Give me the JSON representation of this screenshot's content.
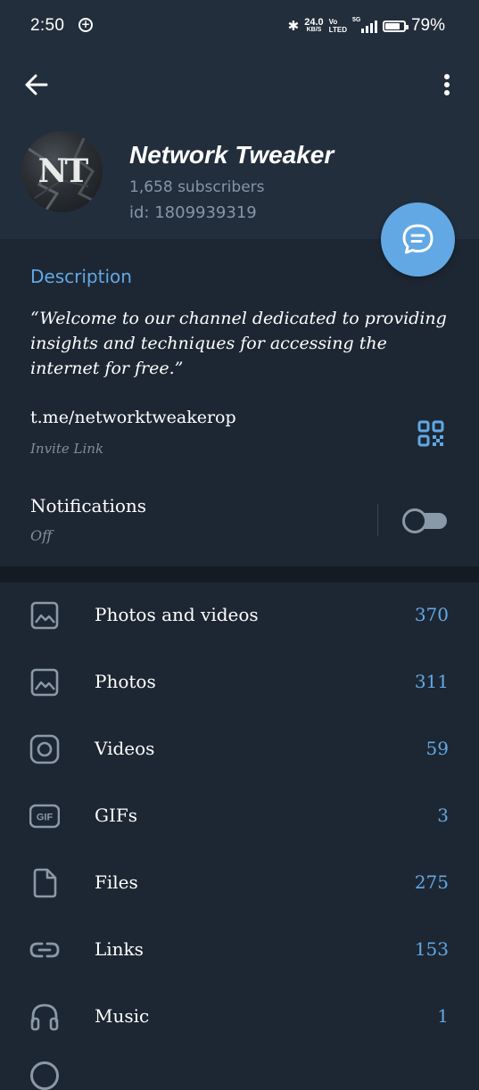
{
  "status_bar": {
    "time": "2:50",
    "speed_value": "24.0",
    "speed_unit": "KB/S",
    "volte_top": "Vo",
    "volte_bottom": "LTED",
    "network": "5G",
    "battery": "79%",
    "battery_level": 0.79
  },
  "header": {
    "avatar_text": "NT",
    "title": "Network Tweaker",
    "subscribers": "1,658 subscribers",
    "id": "id: 1809939319"
  },
  "info": {
    "description_label": "Description",
    "description_text": "“Welcome to our channel dedicated to providing insights and techniques for accessing the internet for free.”",
    "link": "t.me/networktweakerop",
    "link_sub": "Invite Link",
    "notifications_label": "Notifications",
    "notifications_value": "Off",
    "notifications_enabled": false
  },
  "media": [
    {
      "icon": "image-icon",
      "label": "Photos and videos",
      "count": "370"
    },
    {
      "icon": "image-icon",
      "label": "Photos",
      "count": "311"
    },
    {
      "icon": "video-icon",
      "label": "Videos",
      "count": "59"
    },
    {
      "icon": "gif-icon",
      "label": "GIFs",
      "count": "3"
    },
    {
      "icon": "file-icon",
      "label": "Files",
      "count": "275"
    },
    {
      "icon": "link-icon",
      "label": "Links",
      "count": "153"
    },
    {
      "icon": "headphones-icon",
      "label": "Music",
      "count": "1"
    }
  ],
  "colors": {
    "accent": "#62a8e4",
    "background": "#1d2733",
    "header": "#232e3c"
  }
}
